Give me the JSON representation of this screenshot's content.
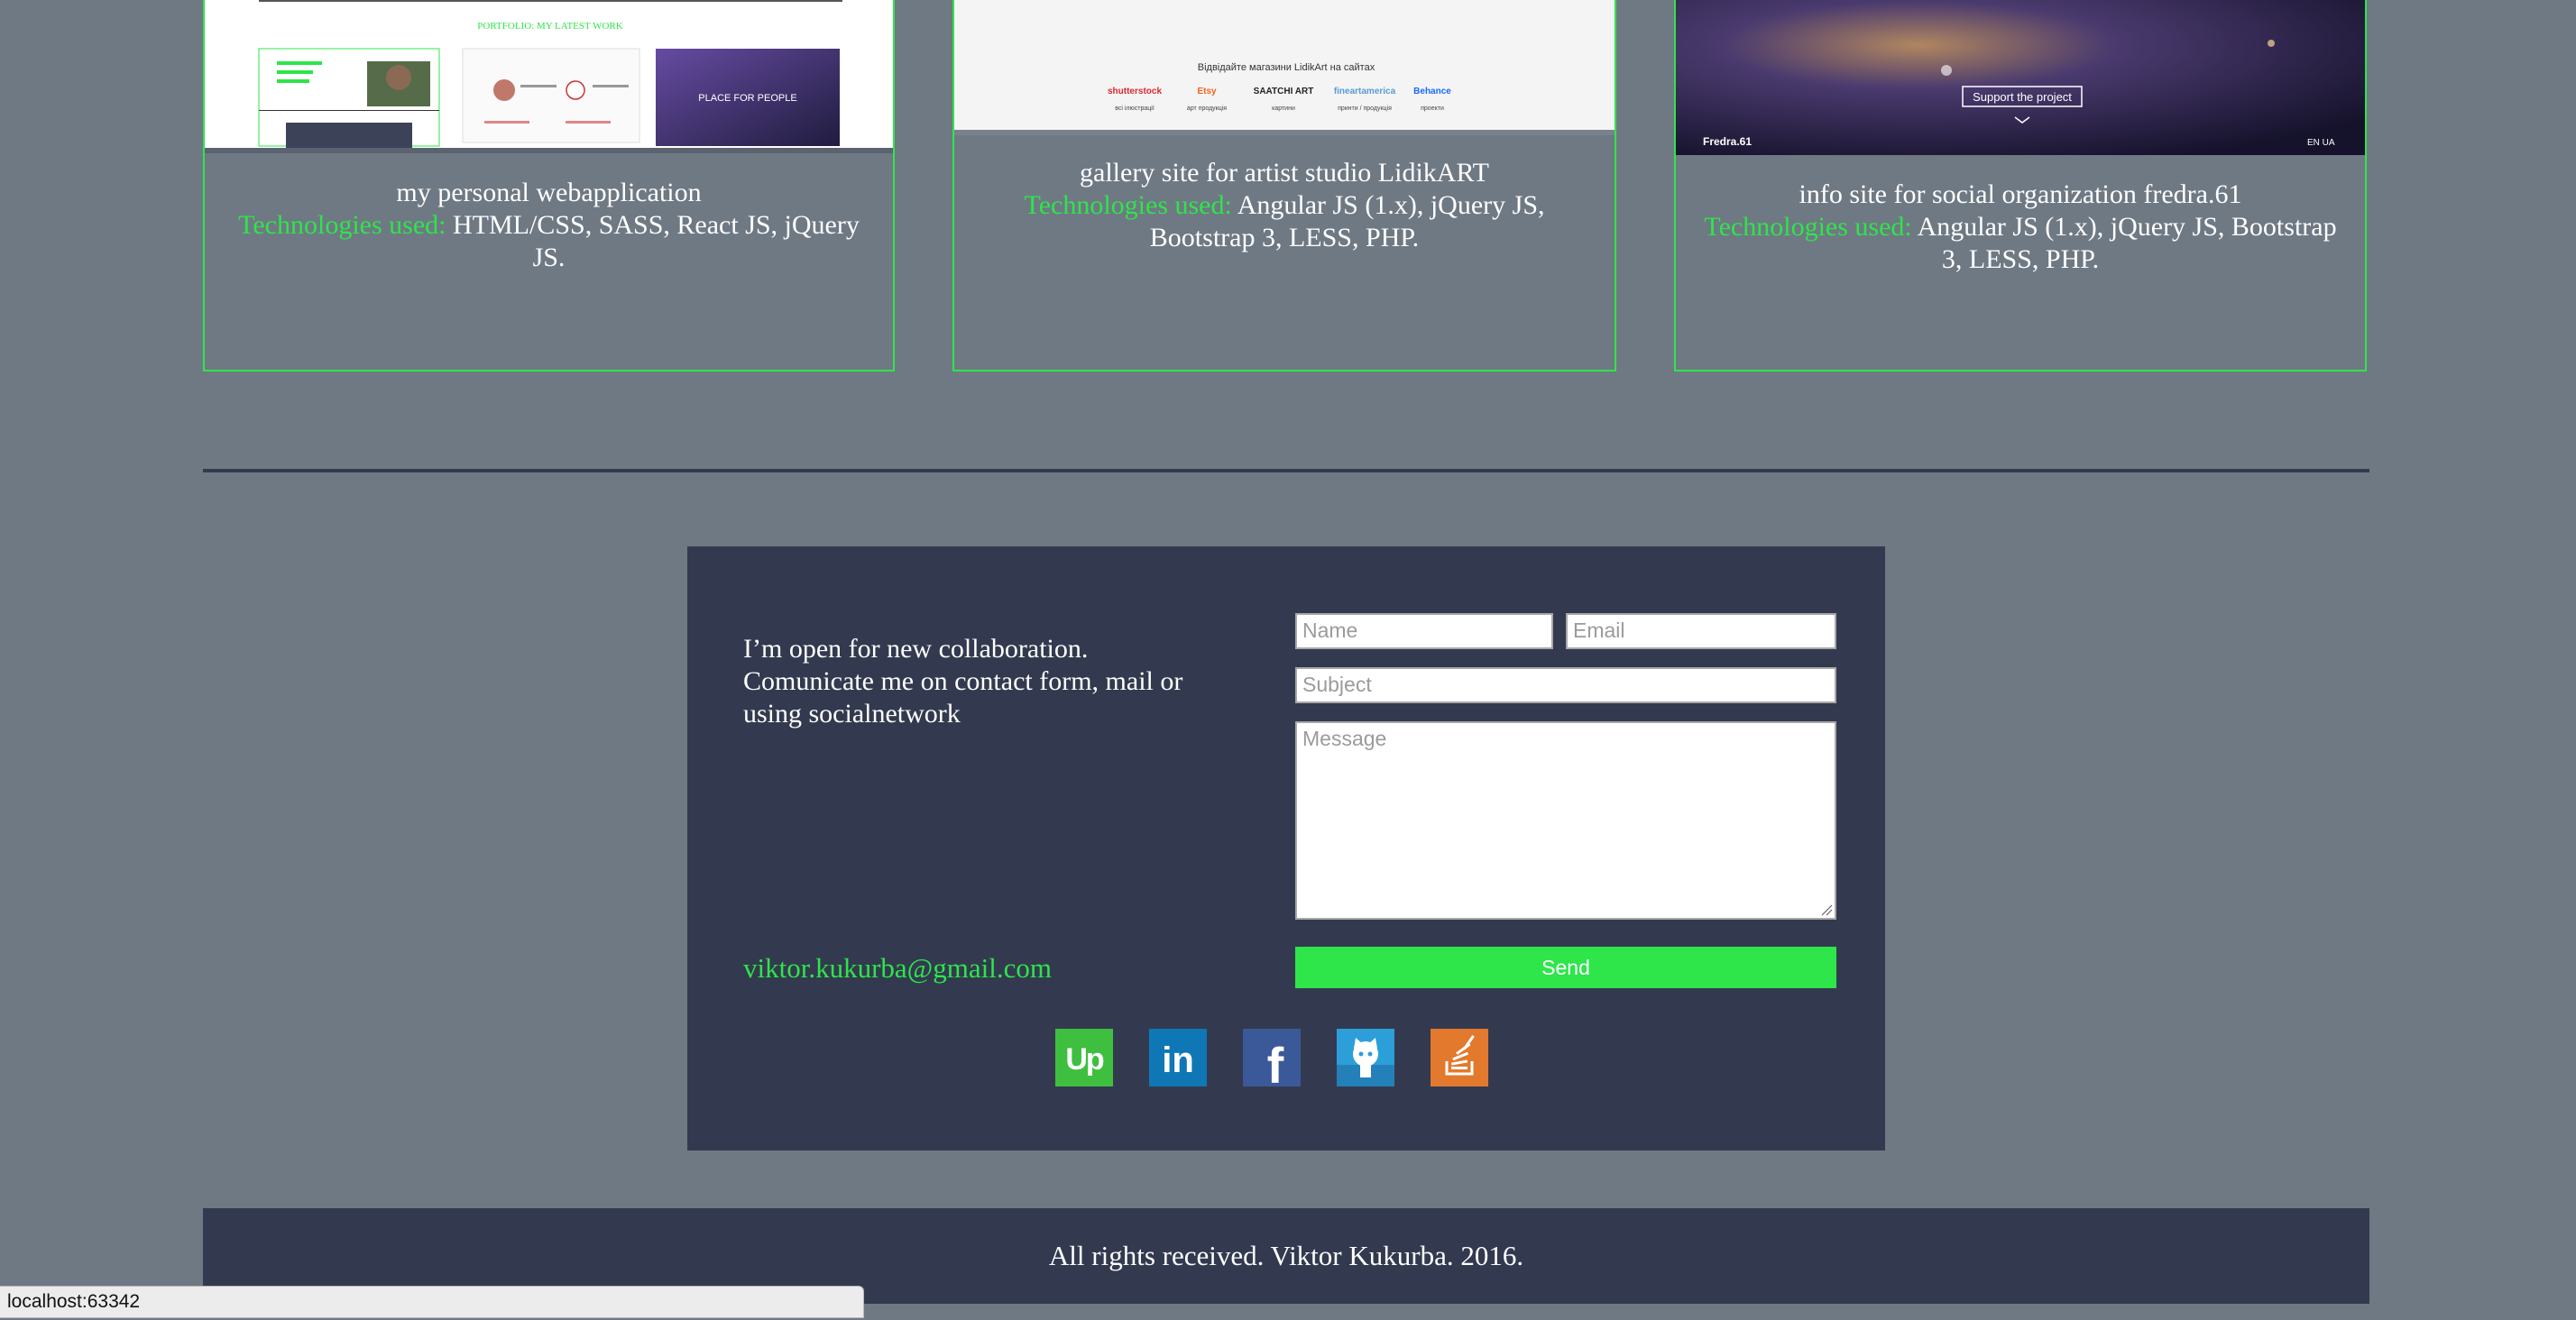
{
  "projects": [
    {
      "title": "my personal webapplication",
      "tech_label": "Technologies used:",
      "tech_list": "HTML/CSS, SASS, React JS, jQuery JS.",
      "thumb": {
        "heading": "PORTFOLIO: MY LATEST WORK",
        "tile_caption": "PLACE FOR PEOPLE"
      }
    },
    {
      "title": "gallery site for artist studio LidikART",
      "tech_label": "Technologies used:",
      "tech_list": "Angular JS (1.x), jQuery JS, Bootstrap 3, LESS, PHP.",
      "thumb": {
        "caption": "Відвідайте магазини LidikArt на сайтах",
        "brands": [
          "shutterstock",
          "Etsy",
          "SAATCHI ART",
          "fineartamerica",
          "Behance"
        ],
        "brand_colors": [
          "#e0262c",
          "#f1641e",
          "#222222",
          "#5a9bd4",
          "#1769ff"
        ],
        "brand_subs": [
          "всі ілюстрації",
          "арт продукція",
          "картини",
          "принти / продукція",
          "проекти"
        ]
      }
    },
    {
      "title": "info site for social organization fredra.61",
      "tech_label": "Technologies used:",
      "tech_list": "Angular JS (1.x), jQuery JS, Bootstrap 3, LESS, PHP.",
      "thumb": {
        "button": "Support the project",
        "brand": "Fredra.61",
        "langs": "EN  UA"
      }
    }
  ],
  "contact": {
    "pitch": "I’m open for new collaboration. Comunicate me on contact form, mail or using socialnetwork",
    "name_placeholder": "Name",
    "email_placeholder": "Email",
    "subject_placeholder": "Subject",
    "message_placeholder": "Message",
    "send_label": "Send",
    "email": "viktor.kukurba@gmail.com",
    "social": [
      {
        "icon": "upwork-icon",
        "glyph": "Up",
        "color": "#3fbf3f"
      },
      {
        "icon": "linkedin-icon",
        "glyph": "in",
        "color": "#0f77b5"
      },
      {
        "icon": "facebook-icon",
        "glyph": "f",
        "color": "#3b5898"
      },
      {
        "icon": "github-icon",
        "glyph": "",
        "color": "#2c9fd9"
      },
      {
        "icon": "stackoverflow-icon",
        "glyph": "",
        "color": "#e2792c"
      }
    ]
  },
  "footer": {
    "text": "All rights received. Viktor Kukurba. 2016."
  },
  "browser": {
    "status_url": "localhost:63342"
  }
}
